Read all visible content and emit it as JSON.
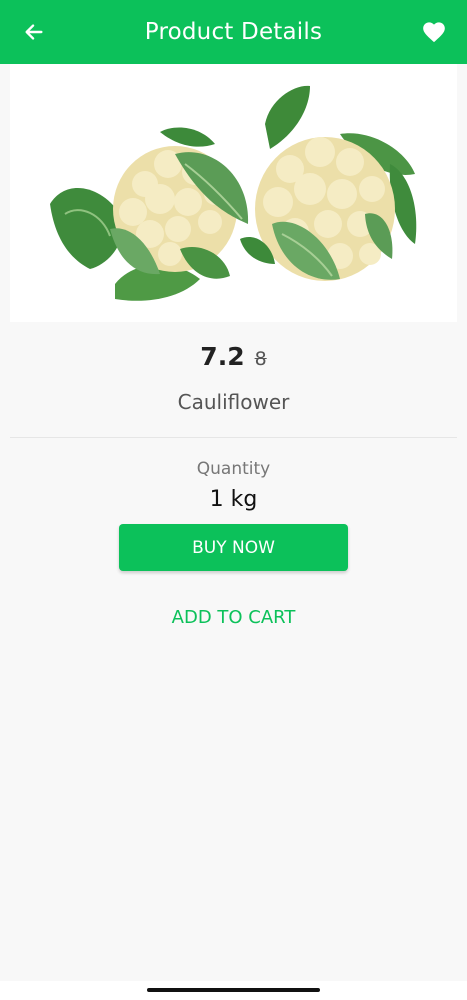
{
  "header": {
    "title": "Product Details",
    "background_color": "#0cc15a",
    "back_icon": "arrow-left-icon",
    "favorite_icon": "heart-icon"
  },
  "product": {
    "image_subject": "cauliflower",
    "price": "7.2",
    "old_price": "8",
    "name": "Cauliflower",
    "quantity_label": "Quantity",
    "quantity_value": "1 kg"
  },
  "actions": {
    "buy_now_label": "BUY NOW",
    "add_to_cart_label": "ADD TO CART",
    "accent_color": "#0cc15a"
  }
}
